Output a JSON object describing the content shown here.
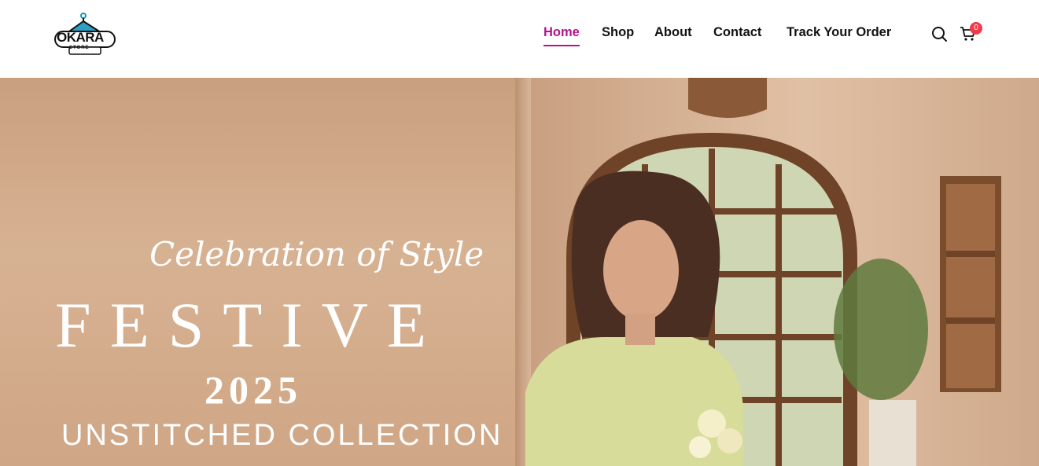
{
  "brand": {
    "name": "OKARA",
    "tagline": "STORE"
  },
  "nav": {
    "items": [
      {
        "label": "Home",
        "active": true
      },
      {
        "label": "Shop",
        "active": false
      },
      {
        "label": "About",
        "active": false
      },
      {
        "label": "Contact",
        "active": false
      },
      {
        "label": "Track Your Order",
        "active": false
      }
    ]
  },
  "header_icons": {
    "search": "search-icon",
    "cart": "cart-icon",
    "cart_count": "0"
  },
  "hero": {
    "script_line": "Celebration of Style",
    "headline": "FESTIVE",
    "year": "2025",
    "subline": "UNSTITCHED COLLECTION"
  },
  "colors": {
    "accent": "#b5128d",
    "badge": "#ef3b4a"
  }
}
